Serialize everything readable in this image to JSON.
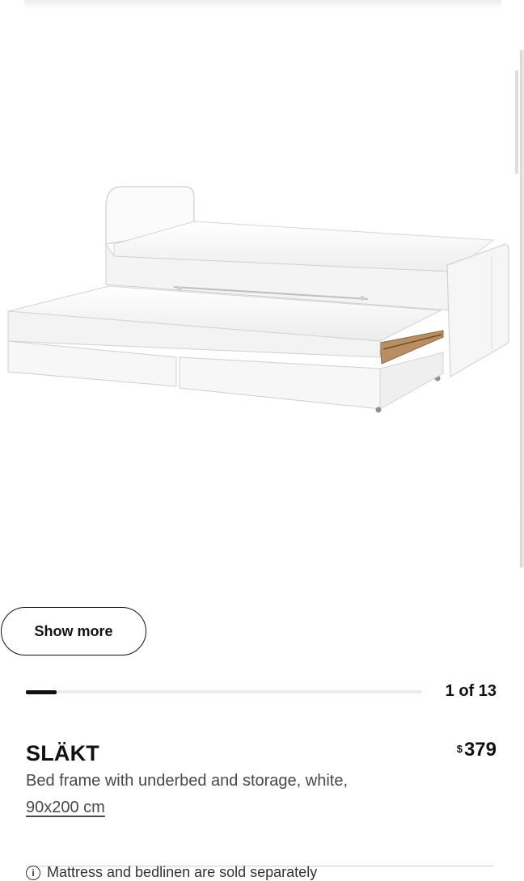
{
  "gallery": {
    "image_alt": "bed-frame-with-underbed-photo",
    "show_more_label": "Show more",
    "counter": "1 of 13",
    "current": 1,
    "total": 13
  },
  "product": {
    "name": "SLÄKT",
    "currency_symbol": "$",
    "price": "379",
    "description": "Bed frame with underbed and storage, white,",
    "size": "90x200 cm",
    "notice": "Mattress and bedlinen are sold separately"
  },
  "colors": {
    "text": "#111111",
    "secondary_text": "#484848",
    "progress_track": "#ededed",
    "progress_thumb": "#111111"
  }
}
